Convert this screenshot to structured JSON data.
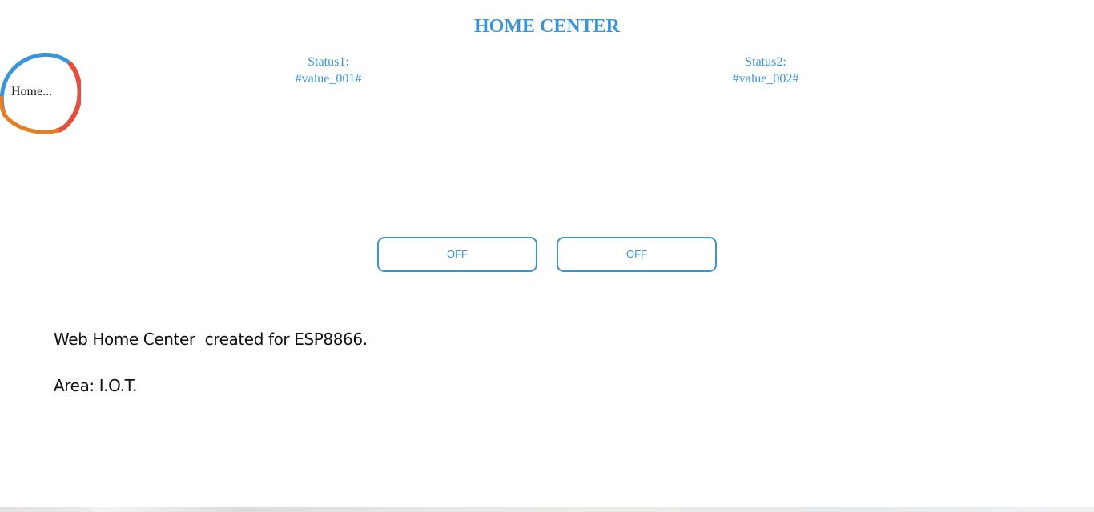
{
  "header": {
    "title": "HOME CENTER"
  },
  "logo": {
    "label": "Home...",
    "colors": [
      "#3a95d8",
      "#e74c3c",
      "#e67e22"
    ]
  },
  "statuses": [
    {
      "label": "Status1:",
      "value": "#value_001#"
    },
    {
      "label": "Status2:",
      "value": "#value_002#"
    }
  ],
  "buttons": [
    {
      "label": "OFF"
    },
    {
      "label": "OFF"
    }
  ],
  "info": {
    "line1": "Web Home Center  created for ESP8866.",
    "line2": "Area: I.O.T."
  },
  "theme": {
    "accent": "#3a95d8"
  }
}
